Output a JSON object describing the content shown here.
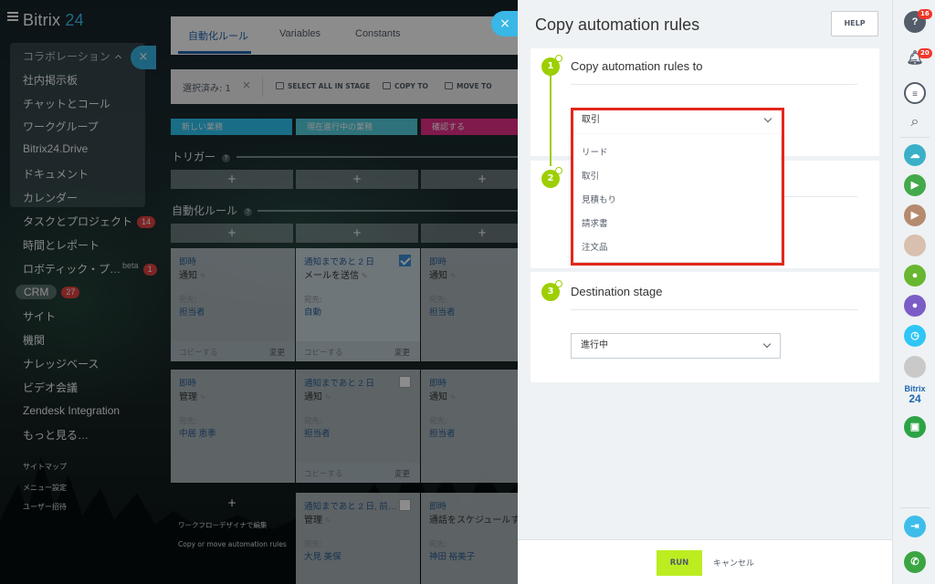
{
  "app": {
    "logo_text": "Bitrix",
    "logo_num": "24"
  },
  "sidebar": {
    "collab_header": "コラボレーション",
    "collab_items": [
      "社内掲示板",
      "チャットとコール",
      "ワークグループ",
      "Bitrix24.Drive",
      "ドキュメント",
      "カレンダー"
    ],
    "items": [
      {
        "label": "タスクとプロジェクト",
        "badge": "14"
      },
      {
        "label": "時間とレポート"
      },
      {
        "label": "ロボティック・プ…",
        "beta": "beta",
        "badge": "1"
      },
      {
        "label": "CRM",
        "badge": "27"
      },
      {
        "label": "サイト"
      },
      {
        "label": "機関"
      },
      {
        "label": "ナレッジベース"
      },
      {
        "label": "ビデオ会議"
      },
      {
        "label": "Zendesk Integration"
      },
      {
        "label": "もっと見る…"
      }
    ],
    "links": [
      "サイトマップ",
      "メニュー設定",
      "ユーザー招待"
    ],
    "close_glyph": "×"
  },
  "page": {
    "tabs": [
      "自動化ルール",
      "Variables",
      "Constants"
    ],
    "selected_count": "選択済み: 1",
    "clear_glyph": "×",
    "actions": [
      "SELECT ALL IN STAGE",
      "COPY TO",
      "MOVE TO"
    ],
    "stages": [
      {
        "name": "新しい業務",
        "color": "#2fc6f6"
      },
      {
        "name": "現在進行中の業務",
        "color": "#55d0e0"
      },
      {
        "name": "確認する",
        "color": "#e92f8a"
      }
    ],
    "triggers_title": "トリガー",
    "rules_title": "自動化ルール",
    "help_glyph": "?",
    "plus": "+",
    "cards": [
      {
        "t1": "即時",
        "t2": "通知",
        "lbl": "宛先:",
        "val": "担当者",
        "copy": "コピーする",
        "edit": "変更"
      },
      {
        "t1": "通知まであと 2 日",
        "t2": "メールを送信",
        "lbl": "宛先:",
        "val": "自動",
        "copy": "コピーする",
        "edit": "変更"
      },
      {
        "t1": "即時",
        "t2": "通知",
        "lbl": "宛先:",
        "val": "担当者"
      },
      {
        "t1": "即時",
        "t2": "管理",
        "lbl": "宛先:",
        "val": "中居 恵季"
      },
      {
        "t1": "通知まであと 2 日",
        "t2": "通知",
        "lbl": "宛先:",
        "val": "担当者",
        "copy": "コピーする",
        "edit": "変更"
      },
      {
        "t1": "即時",
        "t2": "通知",
        "lbl": "宛先:",
        "val": "担当者"
      },
      {
        "t1": "通知まであと 2 日, 前…",
        "t2": "管理",
        "lbl": "宛先:",
        "val": "大見 美保"
      },
      {
        "t1": "即時",
        "t2": "通話をスケジュールす",
        "lbl": "宛先:",
        "val": "神田 裕美子"
      }
    ],
    "bottom_links": [
      "ワークフローデザイナで編集",
      "Copy or move automation rules"
    ]
  },
  "panel": {
    "close_glyph": "×",
    "title": "Copy automation rules",
    "help": "HELP",
    "steps": [
      {
        "num": "1",
        "title": "Copy automation rules to",
        "select": "取引"
      },
      {
        "num": "2"
      },
      {
        "num": "3",
        "title": "Destination stage",
        "select": "進行中"
      }
    ],
    "dropdown": [
      "リード",
      "取引",
      "見積もり",
      "請求書",
      "注文品"
    ],
    "run": "RUN",
    "cancel": "キャンセル"
  },
  "rail": {
    "help_badge": "16",
    "bell_badge": "20",
    "help_glyph": "?",
    "search_glyph": "⌕",
    "brand_small": "Bitrix",
    "brand_num": "24"
  }
}
